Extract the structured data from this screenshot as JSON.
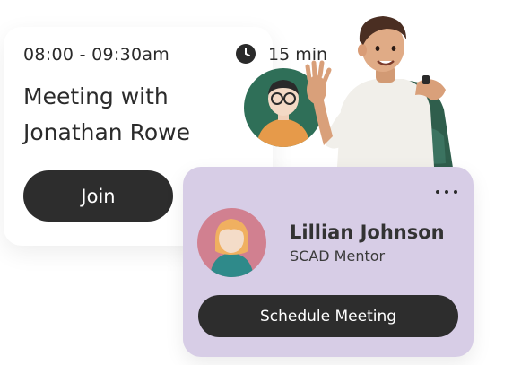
{
  "meeting": {
    "time_range": "08:00 - 09:30am",
    "duration": "15 min",
    "title": "Meeting with Jonathan Rowe",
    "join_label": "Join"
  },
  "mentor": {
    "name": "Lillian Johnson",
    "role": "SCAD Mentor",
    "schedule_label": "Schedule Meeting"
  },
  "icons": {
    "clock": "clock-icon",
    "more": "more-horizontal-icon"
  },
  "colors": {
    "dark_button": "#2d2d2d",
    "mentor_card": "#d7cde6",
    "green_avatar_bg": "#2f6f58",
    "pink_avatar_bg": "#d18090"
  }
}
